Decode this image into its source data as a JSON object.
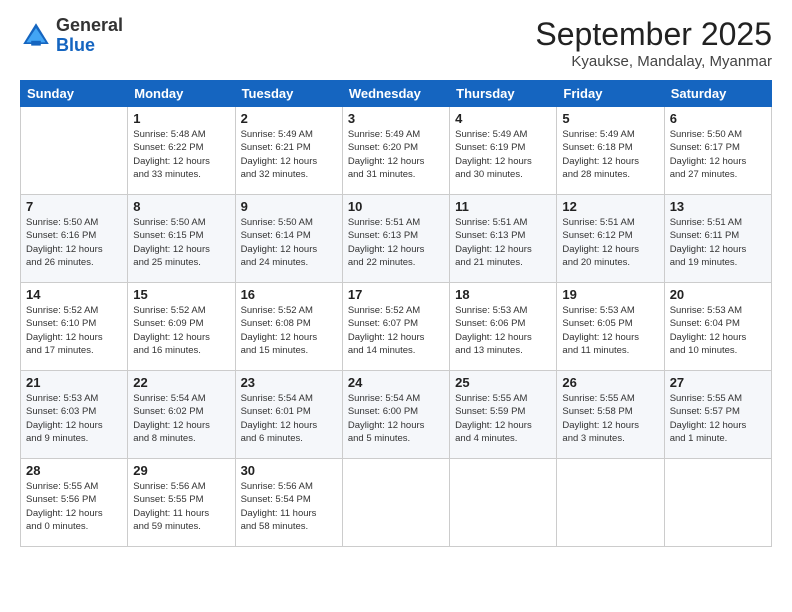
{
  "logo": {
    "general": "General",
    "blue": "Blue"
  },
  "title": {
    "month": "September 2025",
    "location": "Kyaukse, Mandalay, Myanmar"
  },
  "weekdays": [
    "Sunday",
    "Monday",
    "Tuesday",
    "Wednesday",
    "Thursday",
    "Friday",
    "Saturday"
  ],
  "weeks": [
    [
      {
        "day": "",
        "info": ""
      },
      {
        "day": "1",
        "info": "Sunrise: 5:48 AM\nSunset: 6:22 PM\nDaylight: 12 hours\nand 33 minutes."
      },
      {
        "day": "2",
        "info": "Sunrise: 5:49 AM\nSunset: 6:21 PM\nDaylight: 12 hours\nand 32 minutes."
      },
      {
        "day": "3",
        "info": "Sunrise: 5:49 AM\nSunset: 6:20 PM\nDaylight: 12 hours\nand 31 minutes."
      },
      {
        "day": "4",
        "info": "Sunrise: 5:49 AM\nSunset: 6:19 PM\nDaylight: 12 hours\nand 30 minutes."
      },
      {
        "day": "5",
        "info": "Sunrise: 5:49 AM\nSunset: 6:18 PM\nDaylight: 12 hours\nand 28 minutes."
      },
      {
        "day": "6",
        "info": "Sunrise: 5:50 AM\nSunset: 6:17 PM\nDaylight: 12 hours\nand 27 minutes."
      }
    ],
    [
      {
        "day": "7",
        "info": "Sunrise: 5:50 AM\nSunset: 6:16 PM\nDaylight: 12 hours\nand 26 minutes."
      },
      {
        "day": "8",
        "info": "Sunrise: 5:50 AM\nSunset: 6:15 PM\nDaylight: 12 hours\nand 25 minutes."
      },
      {
        "day": "9",
        "info": "Sunrise: 5:50 AM\nSunset: 6:14 PM\nDaylight: 12 hours\nand 24 minutes."
      },
      {
        "day": "10",
        "info": "Sunrise: 5:51 AM\nSunset: 6:13 PM\nDaylight: 12 hours\nand 22 minutes."
      },
      {
        "day": "11",
        "info": "Sunrise: 5:51 AM\nSunset: 6:13 PM\nDaylight: 12 hours\nand 21 minutes."
      },
      {
        "day": "12",
        "info": "Sunrise: 5:51 AM\nSunset: 6:12 PM\nDaylight: 12 hours\nand 20 minutes."
      },
      {
        "day": "13",
        "info": "Sunrise: 5:51 AM\nSunset: 6:11 PM\nDaylight: 12 hours\nand 19 minutes."
      }
    ],
    [
      {
        "day": "14",
        "info": "Sunrise: 5:52 AM\nSunset: 6:10 PM\nDaylight: 12 hours\nand 17 minutes."
      },
      {
        "day": "15",
        "info": "Sunrise: 5:52 AM\nSunset: 6:09 PM\nDaylight: 12 hours\nand 16 minutes."
      },
      {
        "day": "16",
        "info": "Sunrise: 5:52 AM\nSunset: 6:08 PM\nDaylight: 12 hours\nand 15 minutes."
      },
      {
        "day": "17",
        "info": "Sunrise: 5:52 AM\nSunset: 6:07 PM\nDaylight: 12 hours\nand 14 minutes."
      },
      {
        "day": "18",
        "info": "Sunrise: 5:53 AM\nSunset: 6:06 PM\nDaylight: 12 hours\nand 13 minutes."
      },
      {
        "day": "19",
        "info": "Sunrise: 5:53 AM\nSunset: 6:05 PM\nDaylight: 12 hours\nand 11 minutes."
      },
      {
        "day": "20",
        "info": "Sunrise: 5:53 AM\nSunset: 6:04 PM\nDaylight: 12 hours\nand 10 minutes."
      }
    ],
    [
      {
        "day": "21",
        "info": "Sunrise: 5:53 AM\nSunset: 6:03 PM\nDaylight: 12 hours\nand 9 minutes."
      },
      {
        "day": "22",
        "info": "Sunrise: 5:54 AM\nSunset: 6:02 PM\nDaylight: 12 hours\nand 8 minutes."
      },
      {
        "day": "23",
        "info": "Sunrise: 5:54 AM\nSunset: 6:01 PM\nDaylight: 12 hours\nand 6 minutes."
      },
      {
        "day": "24",
        "info": "Sunrise: 5:54 AM\nSunset: 6:00 PM\nDaylight: 12 hours\nand 5 minutes."
      },
      {
        "day": "25",
        "info": "Sunrise: 5:55 AM\nSunset: 5:59 PM\nDaylight: 12 hours\nand 4 minutes."
      },
      {
        "day": "26",
        "info": "Sunrise: 5:55 AM\nSunset: 5:58 PM\nDaylight: 12 hours\nand 3 minutes."
      },
      {
        "day": "27",
        "info": "Sunrise: 5:55 AM\nSunset: 5:57 PM\nDaylight: 12 hours\nand 1 minute."
      }
    ],
    [
      {
        "day": "28",
        "info": "Sunrise: 5:55 AM\nSunset: 5:56 PM\nDaylight: 12 hours\nand 0 minutes."
      },
      {
        "day": "29",
        "info": "Sunrise: 5:56 AM\nSunset: 5:55 PM\nDaylight: 11 hours\nand 59 minutes."
      },
      {
        "day": "30",
        "info": "Sunrise: 5:56 AM\nSunset: 5:54 PM\nDaylight: 11 hours\nand 58 minutes."
      },
      {
        "day": "",
        "info": ""
      },
      {
        "day": "",
        "info": ""
      },
      {
        "day": "",
        "info": ""
      },
      {
        "day": "",
        "info": ""
      }
    ]
  ]
}
